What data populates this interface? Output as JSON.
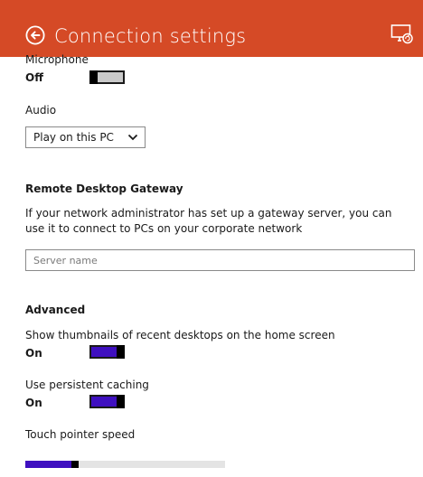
{
  "header": {
    "title": "Connection settings",
    "background": "#d54a26",
    "back_icon": "back-arrow-circle-icon",
    "right_icon": "remote-desktop-icon"
  },
  "microphone": {
    "label": "Microphone",
    "state": "Off"
  },
  "audio": {
    "label": "Audio",
    "selected": "Play on this PC"
  },
  "gateway": {
    "title": "Remote Desktop Gateway",
    "description": "If your network administrator has set up a gateway server, you can use it to connect to PCs on your corporate network",
    "placeholder": "Server name",
    "value": ""
  },
  "advanced": {
    "title": "Advanced",
    "thumbnails": {
      "label": "Show thumbnails of recent desktops on the home screen",
      "state": "On"
    },
    "caching": {
      "label": "Use persistent caching",
      "state": "On"
    },
    "pointer_speed": {
      "label": "Touch pointer speed",
      "value_fraction": 0.24
    }
  },
  "colors": {
    "accent": "#3f10c0",
    "toggle_off": "#c9c9c9"
  }
}
